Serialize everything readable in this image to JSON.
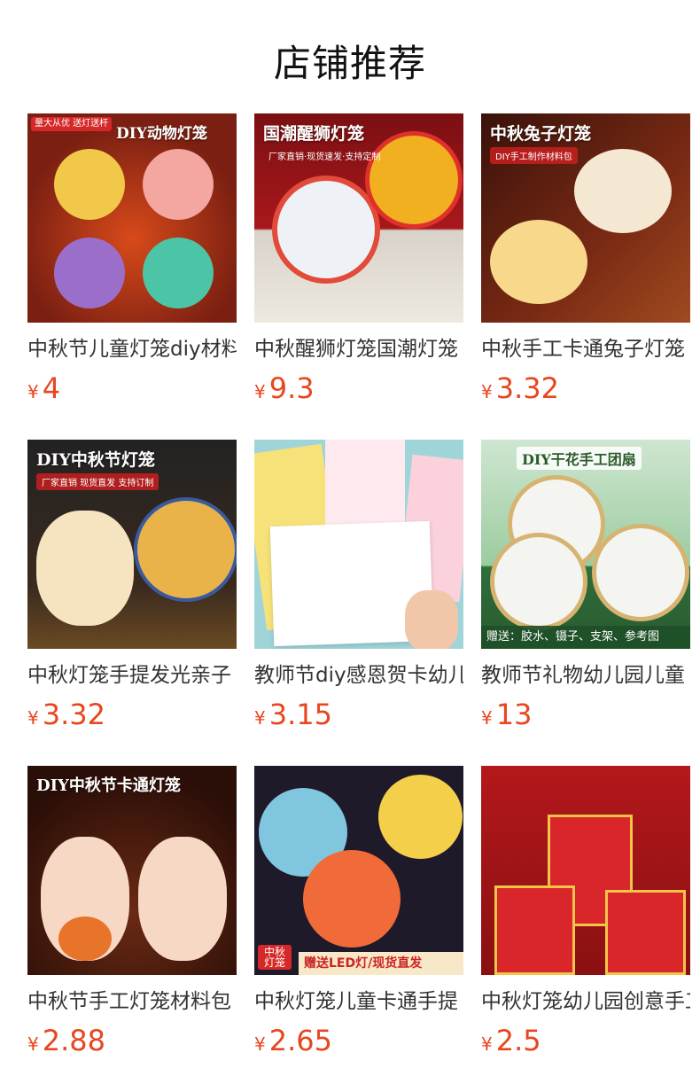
{
  "page": {
    "title": "店铺推荐",
    "currency": "¥"
  },
  "products": [
    {
      "name": "中秋节儿童灯笼diy材料包",
      "price": "4",
      "image": {
        "overlay": "DIY动物灯笼",
        "sub": "",
        "tag": "量大从优 送灯送杆",
        "strip": "",
        "bg": "#7a1f12"
      }
    },
    {
      "name": "中秋醒狮灯笼国潮灯笼",
      "price": "9.3",
      "image": {
        "overlay": "国潮醒狮灯笼",
        "sub": "厂家直销·现货速发·支持定制",
        "tag": "",
        "strip": "",
        "bg": "#8a1414"
      }
    },
    {
      "name": "中秋手工卡通兔子灯笼",
      "price": "3.32",
      "image": {
        "overlay": "中秋兔子灯笼",
        "sub": "DIY手工制作材料包",
        "tag": "",
        "strip": "",
        "bg": "#5a1a10"
      }
    },
    {
      "name": "中秋灯笼手提发光亲子",
      "price": "3.32",
      "image": {
        "overlay": "DIY中秋节灯笼",
        "sub": "厂家直销 现货直发 支持订制",
        "tag": "",
        "strip": "",
        "bg": "#2b2a28"
      }
    },
    {
      "name": "教师节diy感恩贺卡幼儿园",
      "price": "3.15",
      "image": {
        "overlay": "",
        "sub": "",
        "tag": "",
        "strip": "",
        "bg": "#9fd5d8"
      }
    },
    {
      "name": "教师节礼物幼儿园儿童",
      "price": "13",
      "image": {
        "overlay": "DIY干花手工团扇",
        "sub": "",
        "tag": "",
        "strip": "赠送：胶水、镊子、支架、参考图",
        "bg": "#2f6e3a"
      }
    },
    {
      "name": "中秋节手工灯笼材料包",
      "price": "2.88",
      "image": {
        "overlay": "DIY中秋节卡通灯笼",
        "sub": "",
        "tag": "",
        "strip": "",
        "bg": "#4a1a0e"
      }
    },
    {
      "name": "中秋灯笼儿童卡通手提",
      "price": "2.65",
      "image": {
        "overlay": "",
        "sub": "",
        "tag": "中秋 灯笼",
        "strip": "赠送LED灯/现货直发",
        "bg": "#1f1a2a"
      }
    },
    {
      "name": "中秋灯笼幼儿园创意手工",
      "price": "2.5",
      "image": {
        "overlay": "",
        "sub": "",
        "tag": "",
        "strip": "",
        "bg": "#b3181b"
      }
    }
  ]
}
